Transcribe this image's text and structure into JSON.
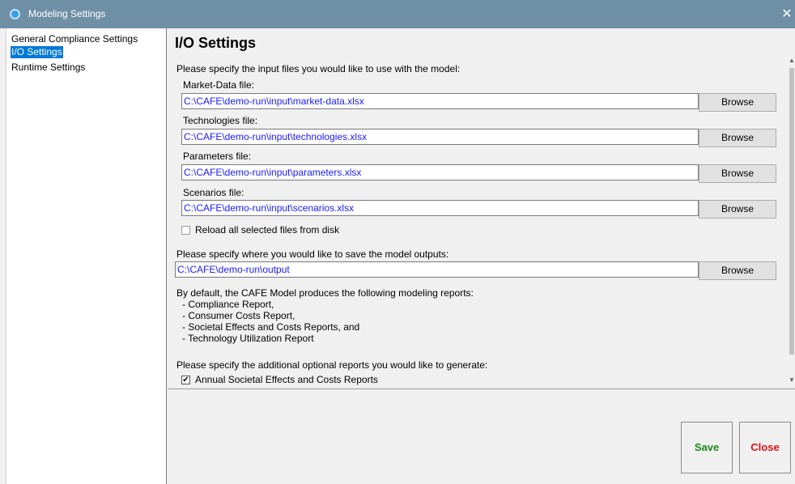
{
  "window": {
    "title": "Modeling Settings",
    "close_glyph": "✕"
  },
  "sidebar": {
    "items": [
      {
        "label": "General Compliance Settings"
      },
      {
        "label": "I/O Settings"
      },
      {
        "label": "Runtime Settings"
      }
    ]
  },
  "io": {
    "heading": "I/O Settings",
    "input_prompt": "Please specify the input files you would like to use with the model:",
    "files": [
      {
        "label": "Market-Data file:",
        "value": "C:\\CAFE\\demo-run\\input\\market-data.xlsx",
        "button": "Browse"
      },
      {
        "label": "Technologies file:",
        "value": "C:\\CAFE\\demo-run\\input\\technologies.xlsx",
        "button": "Browse"
      },
      {
        "label": "Parameters file:",
        "value": "C:\\CAFE\\demo-run\\input\\parameters.xlsx",
        "button": "Browse"
      },
      {
        "label": "Scenarios file:",
        "value": "C:\\CAFE\\demo-run\\input\\scenarios.xlsx",
        "button": "Browse"
      }
    ],
    "reload_label": "Reload all selected files from disk",
    "reload_checked": false,
    "output_prompt": "Please specify where you would like to save the model outputs:",
    "output_value": "C:\\CAFE\\demo-run\\output",
    "output_button": "Browse",
    "reports_intro": "By default, the CAFE Model produces the following modeling reports:",
    "reports": [
      "- Compliance Report,",
      "- Consumer Costs  Report,",
      "- Societal Effects and Costs Reports, and",
      "- Technology Utilization Report"
    ],
    "optional_prompt": "Please specify the additional optional reports you would like to generate:",
    "optional_reports": [
      {
        "label": "Annual Societal Effects and Costs Reports",
        "checked": true
      }
    ]
  },
  "actions": {
    "save_label": "Save",
    "close_label": "Close",
    "save_color": "#1a8a1a",
    "close_color": "#e01010"
  },
  "icons": {
    "app": "gear-icon",
    "checkmark": "✔"
  }
}
